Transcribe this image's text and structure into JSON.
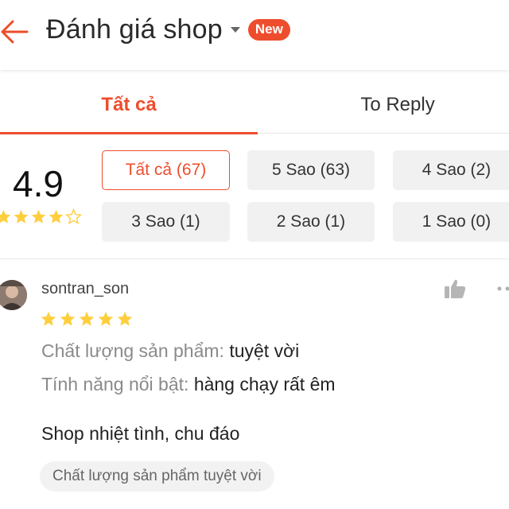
{
  "header": {
    "title": "Đánh giá shop",
    "badge": "New"
  },
  "tabs": [
    {
      "label": "Tất cả",
      "active": true
    },
    {
      "label": "To Reply",
      "active": false
    }
  ],
  "summary": {
    "score": "4.9",
    "stars_filled": 4,
    "stars_total": 5
  },
  "filters": [
    {
      "label": "Tất cả (67)",
      "active": true
    },
    {
      "label": "5 Sao (63)",
      "active": false
    },
    {
      "label": "4 Sao (2)",
      "active": false
    },
    {
      "label": "3 Sao (1)",
      "active": false
    },
    {
      "label": "2 Sao (1)",
      "active": false
    },
    {
      "label": "1 Sao (0)",
      "active": false
    }
  ],
  "review": {
    "username": "sontran_son",
    "stars": 5,
    "attributes": [
      {
        "key": "Chất lượng sản phẩm:",
        "value": "tuyệt vời"
      },
      {
        "key": "Tính năng nổi bật:",
        "value": "hàng chạy rất êm"
      }
    ],
    "comment": "Shop nhiệt tình, chu đáo",
    "tag": "Chất lượng sản phẩm tuyệt vời"
  },
  "colors": {
    "accent": "#ee4d2d",
    "star": "#ffce3d",
    "muted": "#8a8a8a"
  },
  "icons": [
    "back-arrow-icon",
    "caret-down-icon",
    "star-icon",
    "star-outline-icon",
    "thumbs-up-icon",
    "more-icon"
  ]
}
